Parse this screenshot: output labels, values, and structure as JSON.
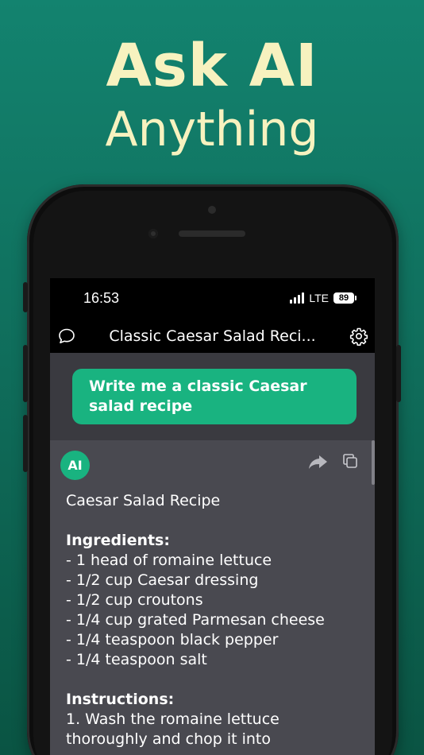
{
  "promo": {
    "line1": "Ask AI",
    "line2": "Anything"
  },
  "status_bar": {
    "time": "16:53",
    "network": "LTE",
    "battery": "89"
  },
  "nav": {
    "title": "Classic Caesar Salad Reci..."
  },
  "user_message": {
    "text": "Write me a classic Caesar salad recipe"
  },
  "ai_message": {
    "avatar": "AI",
    "title": "Caesar Salad Recipe",
    "ingredients_heading": "Ingredients:",
    "ingredients": [
      "- 1 head of romaine lettuce",
      "- 1/2 cup Caesar dressing",
      "- 1/2 cup croutons",
      "- 1/4 cup grated Parmesan cheese",
      "- 1/4 teaspoon black pepper",
      "- 1/4 teaspoon salt"
    ],
    "instructions_heading": "Instructions:",
    "instructions": [
      "1. Wash the romaine lettuce",
      "thoroughly and chop it into"
    ]
  },
  "icons": {
    "chat": "chat-bubble-icon",
    "settings": "gear-icon",
    "share": "share-arrow-icon",
    "copy": "copy-icon"
  },
  "colors": {
    "accent": "#19b380",
    "headline": "#f7f2bf",
    "background": "#13836f"
  }
}
